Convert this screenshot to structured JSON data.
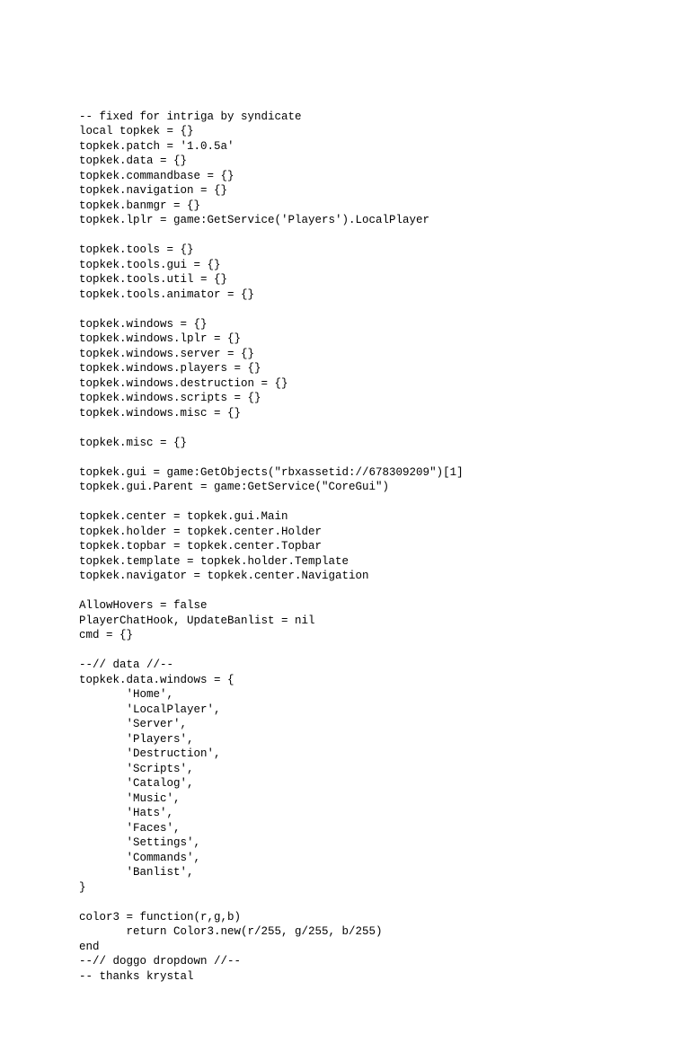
{
  "code": {
    "lines": [
      "-- fixed for intriga by syndicate",
      "local topkek = {}",
      "topkek.patch = '1.0.5a'",
      "topkek.data = {}",
      "topkek.commandbase = {}",
      "topkek.navigation = {}",
      "topkek.banmgr = {}",
      "topkek.lplr = game:GetService('Players').LocalPlayer",
      "",
      "topkek.tools = {}",
      "topkek.tools.gui = {}",
      "topkek.tools.util = {}",
      "topkek.tools.animator = {}",
      "",
      "topkek.windows = {}",
      "topkek.windows.lplr = {}",
      "topkek.windows.server = {}",
      "topkek.windows.players = {}",
      "topkek.windows.destruction = {}",
      "topkek.windows.scripts = {}",
      "topkek.windows.misc = {}",
      "",
      "topkek.misc = {}",
      "",
      "topkek.gui = game:GetObjects(\"rbxassetid://678309209\")[1]",
      "topkek.gui.Parent = game:GetService(\"CoreGui\")",
      "",
      "topkek.center = topkek.gui.Main",
      "topkek.holder = topkek.center.Holder",
      "topkek.topbar = topkek.center.Topbar",
      "topkek.template = topkek.holder.Template",
      "topkek.navigator = topkek.center.Navigation",
      "",
      "AllowHovers = false",
      "PlayerChatHook, UpdateBanlist = nil",
      "cmd = {}",
      "",
      "--// data //--",
      "topkek.data.windows = {",
      "       'Home',",
      "       'LocalPlayer',",
      "       'Server',",
      "       'Players',",
      "       'Destruction',",
      "       'Scripts',",
      "       'Catalog',",
      "       'Music',",
      "       'Hats',",
      "       'Faces',",
      "       'Settings',",
      "       'Commands',",
      "       'Banlist',",
      "}",
      "",
      "color3 = function(r,g,b)",
      "       return Color3.new(r/255, g/255, b/255)",
      "end",
      "--// doggo dropdown //--",
      "-- thanks krystal"
    ]
  }
}
